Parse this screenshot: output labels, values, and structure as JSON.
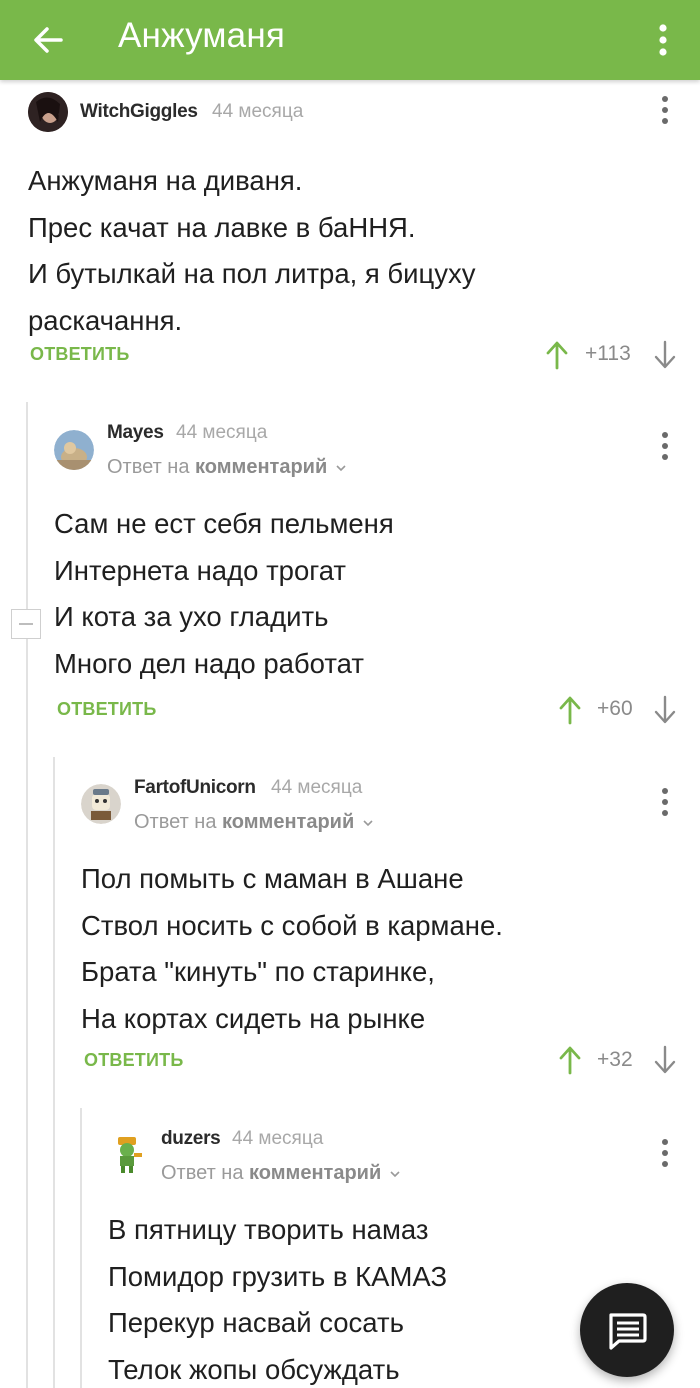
{
  "appbar": {
    "title": "Анжуманя",
    "back_icon": "arrow-left-icon",
    "menu_icon": "more-vert-icon"
  },
  "colors": {
    "accent": "#79b84a",
    "fab": "#1f1f1f"
  },
  "comments": [
    {
      "username": "WitchGiggles",
      "time": "44 месяца",
      "lines": [
        "Анжуманя на диваня.",
        "Прес качат на лавке в баННЯ.",
        "И бутылкай на пол литра, я бицуху",
        "раскачання."
      ],
      "reply_label": "ОТВЕТИТЬ",
      "rating": "+113"
    },
    {
      "username": "Mayes",
      "time": "44 месяца",
      "reply_to_prefix": "Ответ на",
      "reply_to_target": "комментарий",
      "lines": [
        "Сам не ест себя пельменя",
        "Интернета надо трогат",
        "И кота за ухо гладить",
        "Много дел надо работат"
      ],
      "reply_label": "ОТВЕТИТЬ",
      "rating": "+60"
    },
    {
      "username": "FartofUnicorn",
      "time": "44 месяца",
      "reply_to_prefix": "Ответ на",
      "reply_to_target": "комментарий",
      "lines": [
        "Пол помыть с маман в Ашане",
        "Ствол носить с собой в кармане.",
        "Брата \"кинуть\" по старинке,",
        "На кортах сидеть на рынке"
      ],
      "reply_label": "ОТВЕТИТЬ",
      "rating": "+32"
    },
    {
      "username": "duzers",
      "time": "44 месяца",
      "reply_to_prefix": "Ответ на",
      "reply_to_target": "комментарий",
      "lines": [
        "В пятницу творить намаз",
        "Помидор грузить в КАМАЗ",
        "Перекур насвай сосать",
        "Телок жопы обсуждать"
      ]
    }
  ],
  "fab": {
    "icon": "comment-icon"
  }
}
